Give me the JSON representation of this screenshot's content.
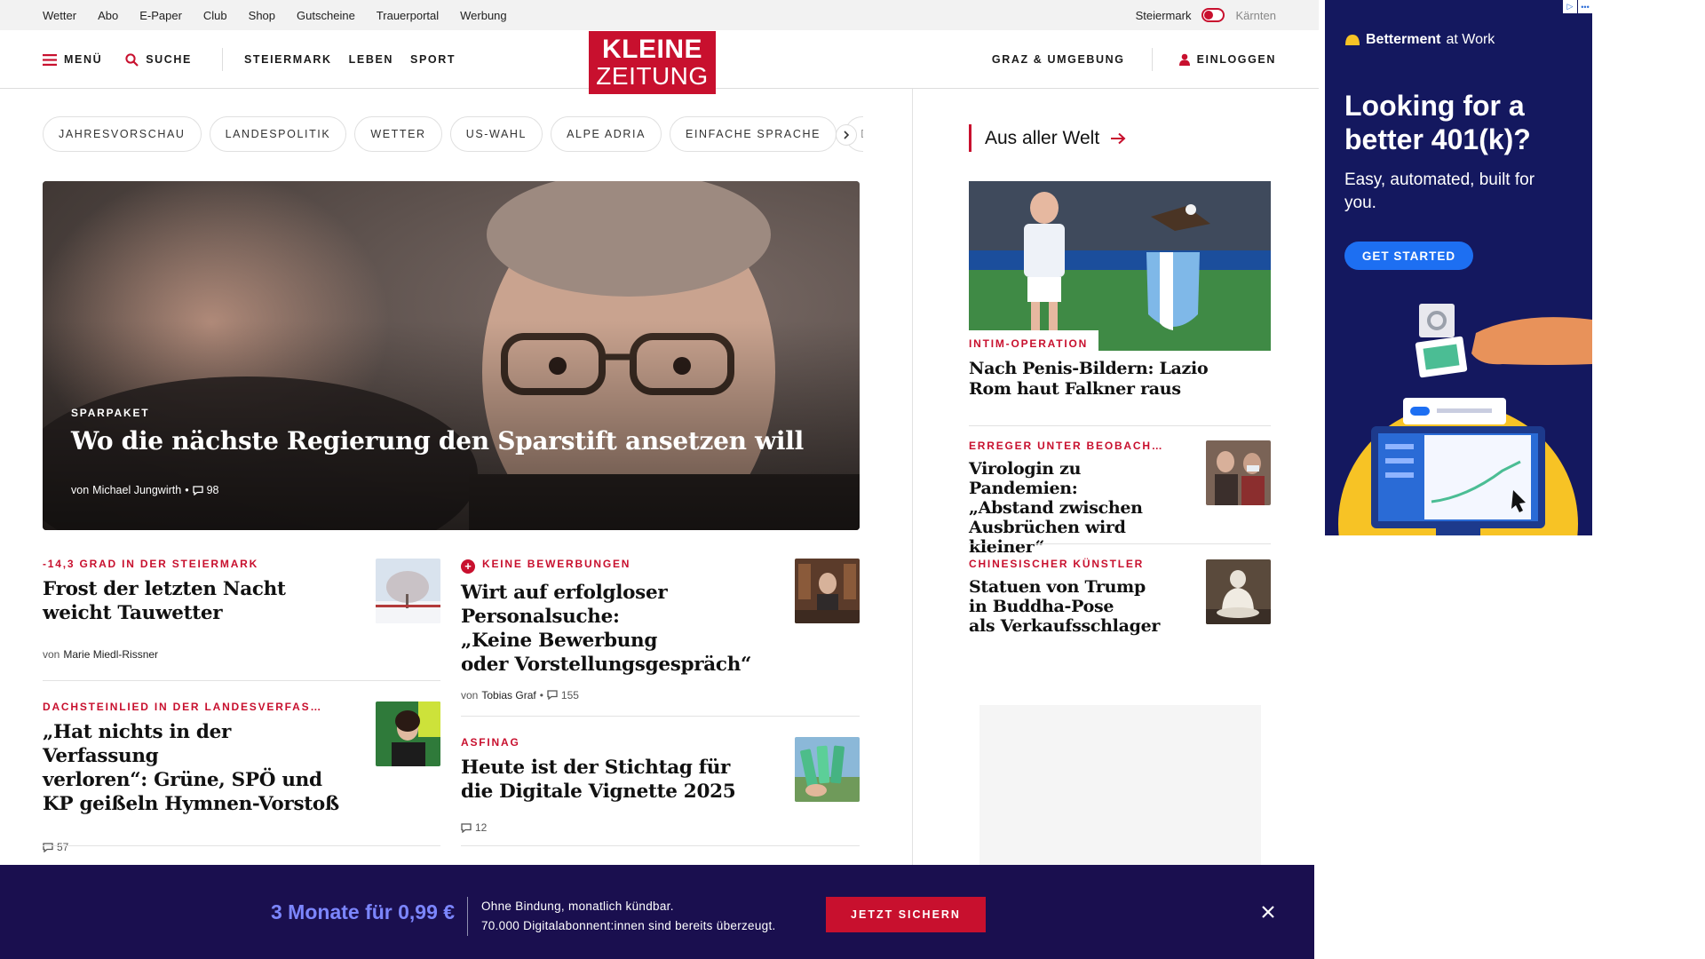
{
  "util_nav": {
    "links": [
      "Wetter",
      "Abo",
      "E-Paper",
      "Club",
      "Shop",
      "Gutscheine",
      "Trauerportal",
      "Werbung"
    ],
    "region_active": "Steiermark",
    "region_inactive": "Kärnten"
  },
  "header": {
    "menu_label": "MENÜ",
    "search_label": "SUCHE",
    "nav": [
      "STEIERMARK",
      "LEBEN",
      "SPORT"
    ],
    "logo_line1": "KLEINE",
    "logo_line2": "ZEITUNG",
    "region_link": "GRAZ & UMGEBUNG",
    "login_label": "EINLOGGEN"
  },
  "topics": [
    "JAHRESVORSCHAU",
    "LANDESPOLITIK",
    "WETTER",
    "US-WAHL",
    "ALPE ADRIA",
    "EINFACHE SPRACHE",
    "DOS"
  ],
  "hero": {
    "kicker": "SPARPAKET",
    "title": "Wo die nächste Regierung den Sparstift ansetzen will",
    "author_prefix": "von",
    "author": "Michael Jungwirth",
    "comments": "98"
  },
  "articles": [
    {
      "kicker": "-14,3 GRAD IN DER STEIERMARK",
      "title": [
        "Frost der letzten Nacht",
        "weicht Tauwetter"
      ],
      "author_prefix": "von",
      "author": "Marie Miedl-Rissner",
      "comments": ""
    },
    {
      "kicker": "KEINE BEWERBUNGEN",
      "title": [
        "Wirt auf erfolgloser",
        "Personalsuche:",
        "„Keine Bewerbung",
        "oder Vorstellungsgespräch“"
      ],
      "author_prefix": "von",
      "author": "Tobias Graf",
      "comments": "155"
    },
    {
      "kicker": "DACHSTEINLIED IN DER LANDESVERFAS…",
      "title": [
        "„Hat nichts in der Verfassung",
        "verloren“: Grüne, SPÖ und",
        "KP geißeln Hymnen-Vorstoß"
      ],
      "comments": "57"
    },
    {
      "kicker": "ASFINAG",
      "title": [
        "Heute ist der Stichtag für",
        "die Digitale Vignette 2025"
      ],
      "comments": "12"
    }
  ],
  "sidebar": {
    "heading": "Aus aller Welt",
    "items": [
      {
        "kicker": "INTIM-OPERATION",
        "title": [
          "Nach Penis-Bildern: Lazio",
          "Rom haut Falkner raus"
        ]
      },
      {
        "kicker": "ERREGER UNTER BEOBACH…",
        "title": [
          "Virologin zu Pandemien:",
          "„Abstand zwischen",
          "Ausbrüchen wird kleiner“"
        ]
      },
      {
        "kicker": "CHINESISCHER KÜNSTLER",
        "title": [
          "Statuen von Trump",
          "in Buddha-Pose",
          "als Verkaufsschlager"
        ]
      }
    ]
  },
  "ad": {
    "brand_bold": "Betterment",
    "brand_rest": "at Work",
    "headline": "Looking for a better 401(k)?",
    "subline": "Easy, automated, built for you.",
    "cta": "GET STARTED",
    "colors": {
      "background": "#14185f",
      "cta": "#1d6ff2",
      "sun": "#f7c325"
    }
  },
  "banner": {
    "price": "3 Monate für 0,99 €",
    "line1": "Ohne Bindung, monatlich kündbar.",
    "line2": "70.000 Digitalabonnent:innen sind bereits überzeugt.",
    "cta": "JETZT SICHERN"
  },
  "colors": {
    "brand_red": "#c8102e",
    "banner_bg": "#1a0f4f",
    "banner_price": "#7c86ff"
  }
}
